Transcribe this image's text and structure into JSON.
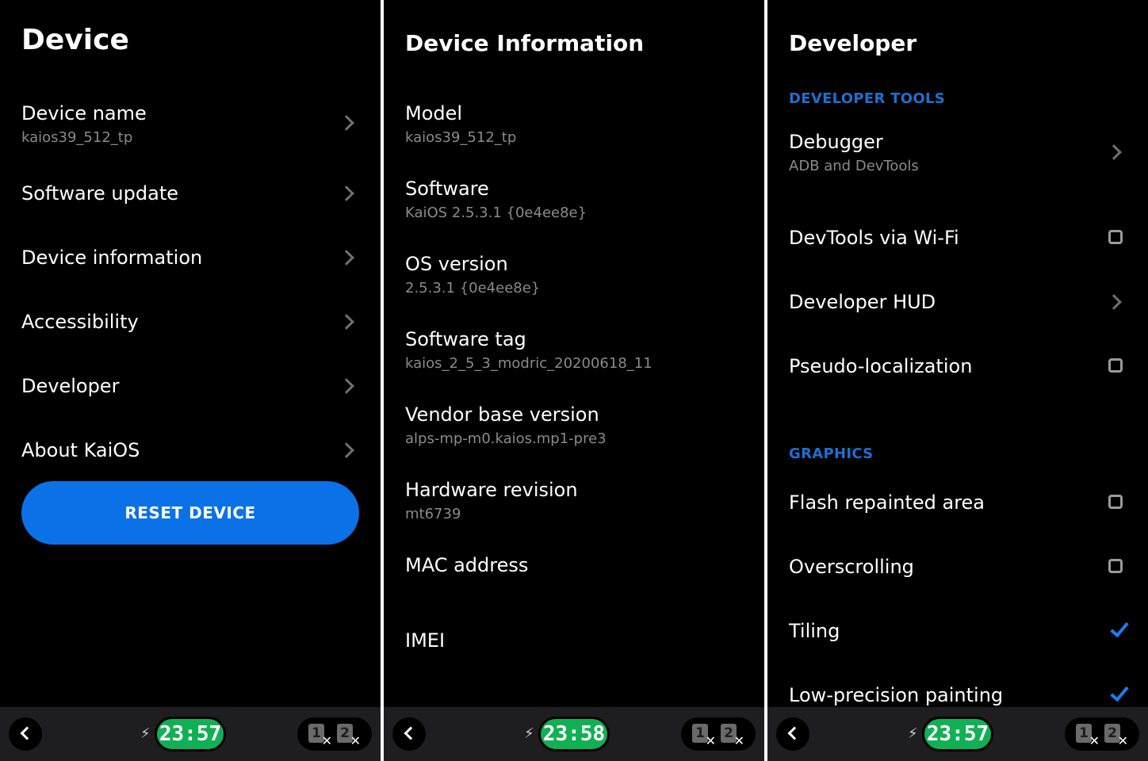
{
  "panels": {
    "device": {
      "title": "Device",
      "items": [
        {
          "label": "Device name",
          "sub": "kaios39_512_tp"
        },
        {
          "label": "Software update"
        },
        {
          "label": "Device information"
        },
        {
          "label": "Accessibility"
        },
        {
          "label": "Developer"
        },
        {
          "label": "About KaiOS"
        }
      ],
      "reset_label": "RESET DEVICE",
      "clock": "23:57"
    },
    "info": {
      "title": "Device Information",
      "items": [
        {
          "label": "Model",
          "sub": "kaios39_512_tp"
        },
        {
          "label": "Software",
          "sub": "KaiOS 2.5.3.1 {0e4ee8e}"
        },
        {
          "label": "OS version",
          "sub": "2.5.3.1 {0e4ee8e}"
        },
        {
          "label": "Software tag",
          "sub": "kaios_2_5_3_modric_20200618_11"
        },
        {
          "label": "Vendor base version",
          "sub": "alps-mp-m0.kaios.mp1-pre3"
        },
        {
          "label": "Hardware revision",
          "sub": "mt6739"
        },
        {
          "label": "MAC address"
        },
        {
          "label": "IMEI"
        }
      ],
      "clock": "23:58"
    },
    "developer": {
      "title": "Developer",
      "section_tools": "DEVELOPER TOOLS",
      "section_graphics": "GRAPHICS",
      "items": [
        {
          "label": "Debugger",
          "sub": "ADB and DevTools",
          "control": "chevron"
        },
        {
          "label": "DevTools via Wi-Fi",
          "control": "checkbox",
          "checked": false
        },
        {
          "label": "Developer HUD",
          "control": "chevron"
        },
        {
          "label": "Pseudo-localization",
          "control": "checkbox",
          "checked": false
        },
        {
          "label": "Flash repainted area",
          "control": "checkbox",
          "checked": false
        },
        {
          "label": "Overscrolling",
          "control": "checkbox",
          "checked": false
        },
        {
          "label": "Tiling",
          "control": "checkbox",
          "checked": true
        },
        {
          "label": "Low-precision painting",
          "control": "checkbox",
          "checked": true
        }
      ],
      "clock": "23:57"
    }
  },
  "softbar": {
    "back_icon": "chevron-left-icon",
    "charging_icon": "lightning-bolt-icon",
    "bolt_glyph": "⚡",
    "sim1": "1",
    "sim2": "2",
    "sim_x": "✕"
  },
  "colors": {
    "background": "#000000",
    "accent": "#0a72e6",
    "section": "#1f6fd1",
    "clock": "#12b054",
    "check": "#1d7ef0"
  }
}
